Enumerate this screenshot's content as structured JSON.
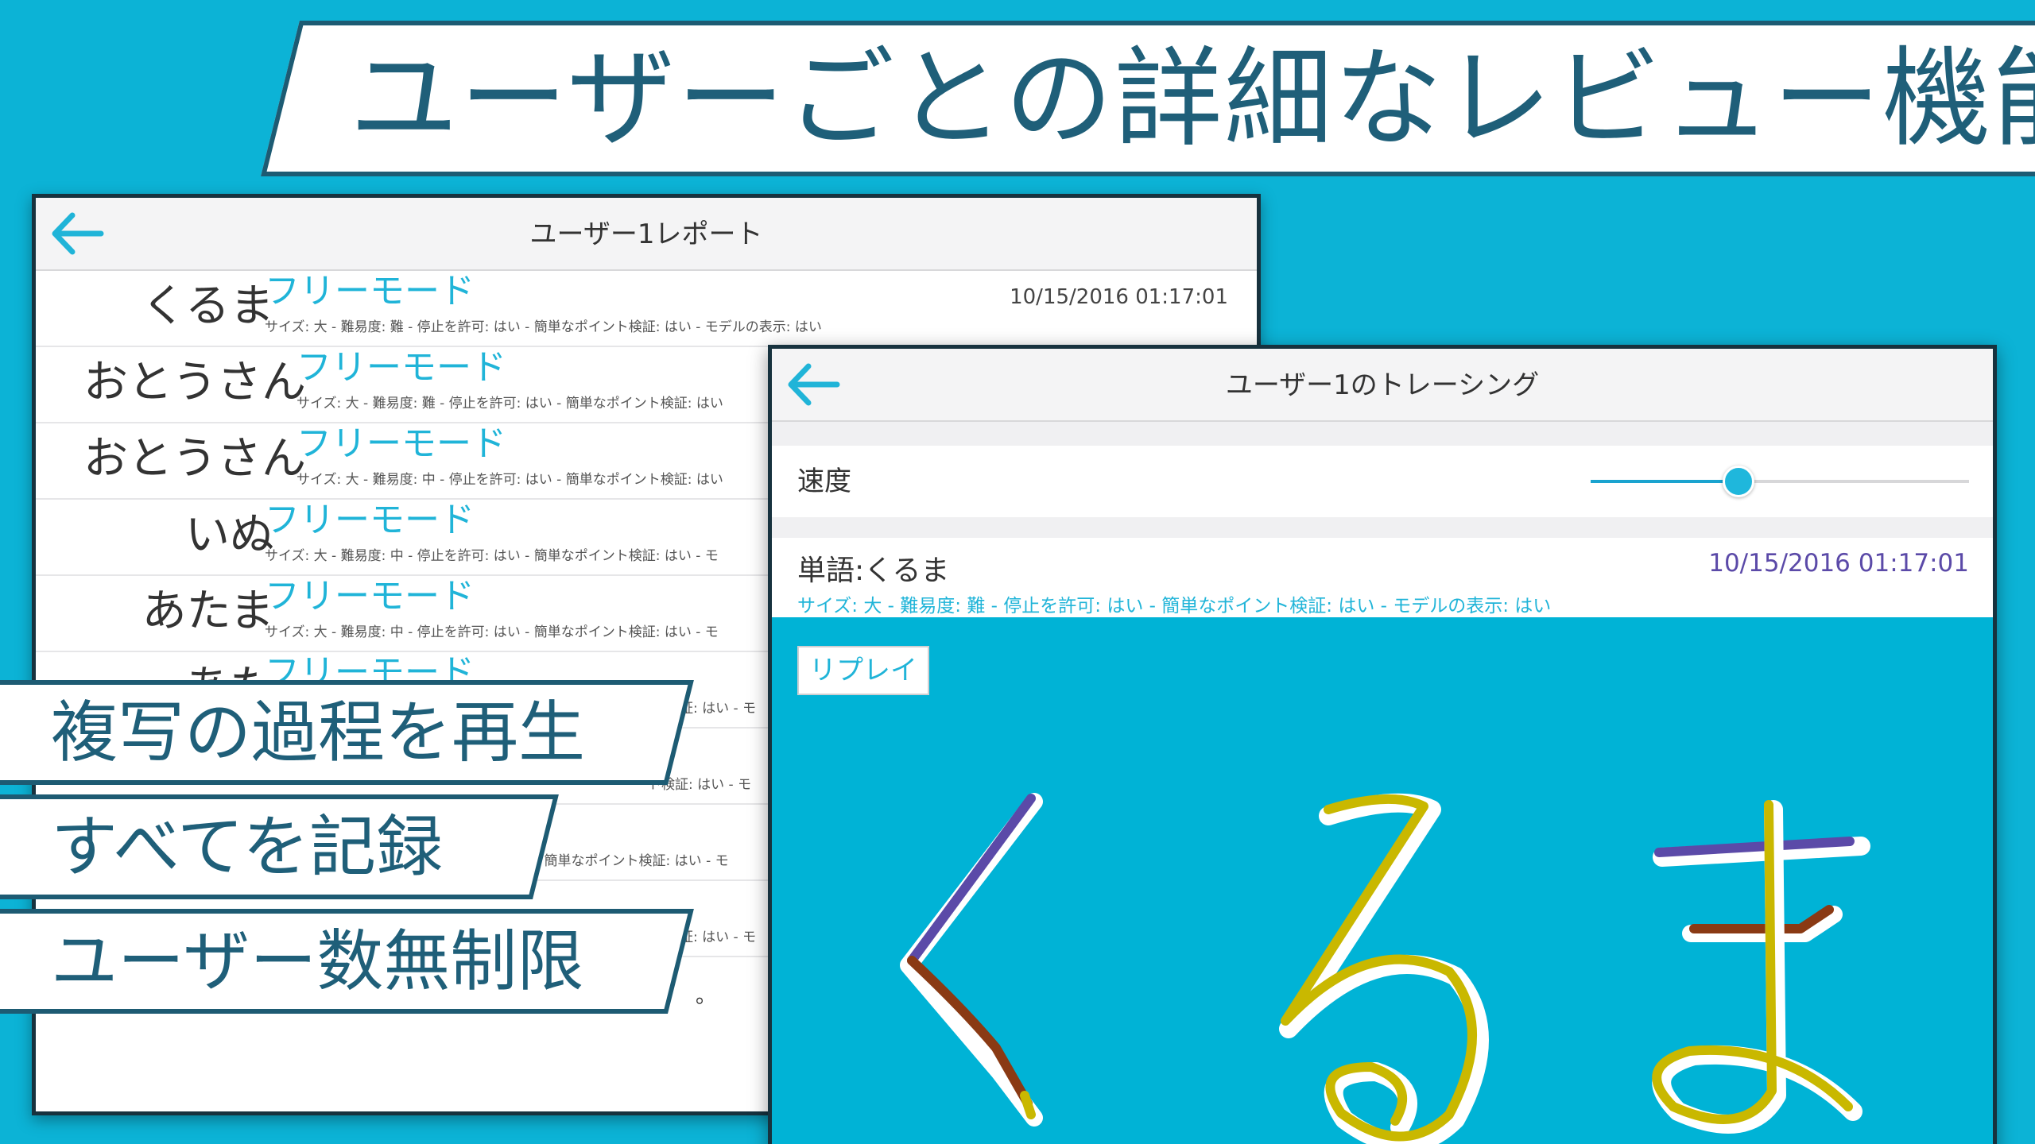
{
  "banner": {
    "title": "ユーザーごとの詳細なレビュー機能"
  },
  "report": {
    "title": "ユーザー1レポート",
    "rows": [
      {
        "word": "くるま",
        "mode": "フリーモード",
        "info": "サイズ: 大 - 難易度: 難 - 停止を許可: はい - 簡単なポイント検証: はい - モデルの表示: はい",
        "date": "10/15/2016    01:17:01"
      },
      {
        "word": "おとうさん",
        "mode": "フリーモード",
        "info": "サイズ: 大 - 難易度: 難 - 停止を許可: はい - 簡単なポイント検証: はい",
        "date": ""
      },
      {
        "word": "おとうさん",
        "mode": "フリーモード",
        "info": "サイズ: 大 - 難易度: 中 - 停止を許可: はい - 簡単なポイント検証: はい",
        "date": ""
      },
      {
        "word": "いぬ",
        "mode": "フリーモード",
        "info": "サイズ: 大 - 難易度: 中 - 停止を許可: はい - 簡単なポイント検証: はい - モ",
        "date": ""
      },
      {
        "word": "あたま",
        "mode": "フリーモード",
        "info": "サイズ: 大 - 難易度: 中 - 停止を許可: はい - 簡単なポイント検証: はい - モ",
        "date": ""
      },
      {
        "word": "あた",
        "mode": "フリーモード",
        "info": "証: はい - モ",
        "date": ""
      },
      {
        "word": "",
        "mode": "",
        "info": "ト検証: はい - モ",
        "date": ""
      },
      {
        "word": "",
        "mode": "",
        "info": "- 簡単なポイント検証: はい - モ",
        "date": ""
      },
      {
        "word": "",
        "mode": "",
        "info": "証: はい - モ",
        "date": ""
      }
    ],
    "footer_dot": "。"
  },
  "tracing": {
    "title": "ユーザー1のトレーシング",
    "speed_label": "速度",
    "speed_value": 0.39,
    "word_label": "単語:くるま",
    "date": "10/15/2016 01:17:01",
    "info": "サイズ: 大 - 難易度: 難 - 停止を許可: はい - 簡単なポイント検証: はい - モデルの表示: はい",
    "replay_label": "リプレイ",
    "stroke_colors": {
      "purple": "#5b4aa8",
      "brown": "#8a3a14",
      "yellow": "#c9b800",
      "outline": "#ffffff"
    }
  },
  "features": [
    {
      "label": "複写の過程を再生"
    },
    {
      "label": "すべてを記録"
    },
    {
      "label": "ユーザー数無制限"
    }
  ]
}
